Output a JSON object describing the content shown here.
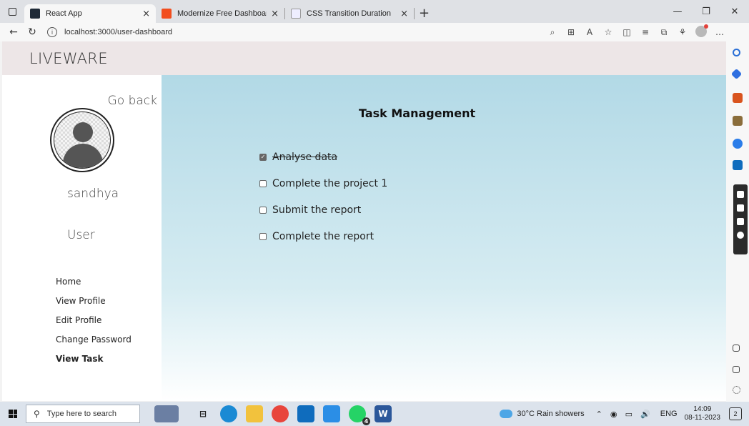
{
  "browser": {
    "tabs": [
      {
        "label": "React App",
        "active": true,
        "favicon_color": "#1f2a37"
      },
      {
        "label": "Modernize Free Dashboard Desi",
        "active": false,
        "favicon_color": "#f24e1e"
      },
      {
        "label": "CSS Transition Duration",
        "active": false,
        "favicon_color": "#dfe1e5"
      }
    ],
    "url": "localhost:3000/user-dashboard",
    "new_tab": "+",
    "close_glyph": "×"
  },
  "app": {
    "brand": "LIVEWARE",
    "go_back": "Go back",
    "username": "sandhya",
    "role": "User",
    "menu": [
      {
        "label": "Home",
        "active": false
      },
      {
        "label": "View Profile",
        "active": false
      },
      {
        "label": "Edit Profile",
        "active": false
      },
      {
        "label": "Change Password",
        "active": false
      },
      {
        "label": "View Task",
        "active": true
      }
    ],
    "main_title": "Task Management",
    "tasks": [
      {
        "label": "Analyse data",
        "done": true
      },
      {
        "label": "Complete the project 1",
        "done": false
      },
      {
        "label": "Submit the report",
        "done": false
      },
      {
        "label": "Complete the report",
        "done": false
      }
    ]
  },
  "taskbar": {
    "search_placeholder": "Type here to search",
    "weather": "30°C  Rain showers",
    "lang": "ENG",
    "time": "14:09",
    "date": "08-11-2023",
    "notification_count": "2",
    "whatsapp_badge": "4"
  },
  "colors": {
    "header_bg": "#ede6e7",
    "main_gradient_top": "#b2d9e6",
    "taskbar_bg": "#dce3ec"
  }
}
